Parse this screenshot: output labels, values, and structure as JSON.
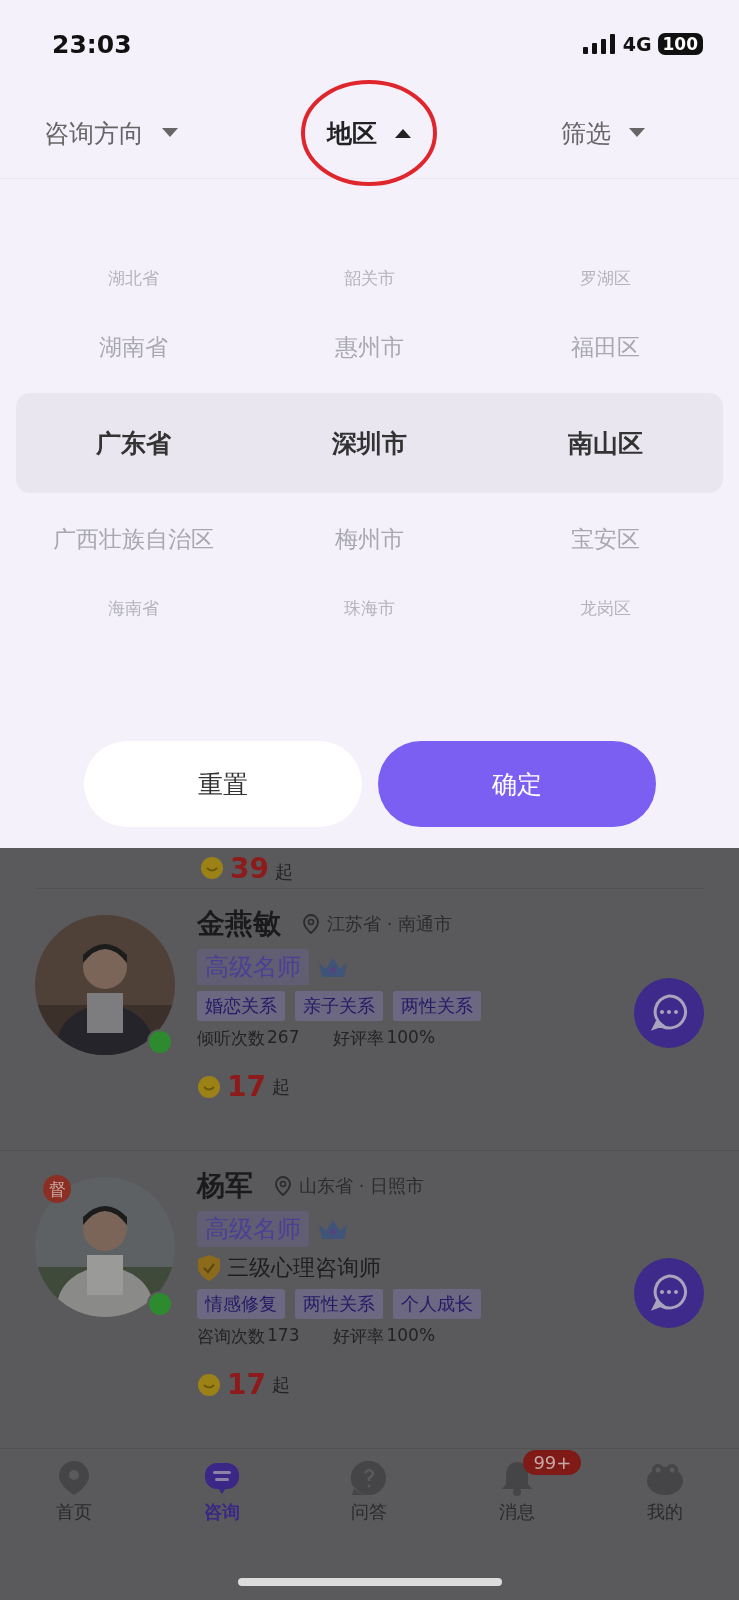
{
  "status_bar": {
    "time": "23:03",
    "network": "4G",
    "battery": "100"
  },
  "filter_tabs": [
    {
      "label": "咨询方向",
      "selected": false,
      "circled": false
    },
    {
      "label": "地区",
      "selected": true,
      "circled": true
    },
    {
      "label": "筛选",
      "selected": false,
      "circled": false
    }
  ],
  "picker": {
    "columns": [
      {
        "items": [
          {
            "label": "湖北省",
            "selected": false
          },
          {
            "label": "湖南省",
            "selected": false
          },
          {
            "label": "广东省",
            "selected": true
          },
          {
            "label": "广西壮族自治区",
            "selected": false
          },
          {
            "label": "海南省",
            "selected": false
          }
        ]
      },
      {
        "items": [
          {
            "label": "韶关市",
            "selected": false
          },
          {
            "label": "惠州市",
            "selected": false
          },
          {
            "label": "深圳市",
            "selected": true
          },
          {
            "label": "梅州市",
            "selected": false
          },
          {
            "label": "珠海市",
            "selected": false
          }
        ]
      },
      {
        "items": [
          {
            "label": "罗湖区",
            "selected": false
          },
          {
            "label": "福田区",
            "selected": false
          },
          {
            "label": "南山区",
            "selected": true
          },
          {
            "label": "宝安区",
            "selected": false
          },
          {
            "label": "龙岗区",
            "selected": false
          }
        ]
      }
    ]
  },
  "buttons": [
    {
      "label": "重置",
      "kind": "secondary"
    },
    {
      "label": "确定",
      "kind": "primary"
    }
  ],
  "list": {
    "previous_price": {
      "amount": "39",
      "unit": "起"
    },
    "counselors": [
      {
        "name": "金燕敏",
        "location": "江苏省 · 南通市",
        "title": "高级名师",
        "tags": [
          "婚恋关系",
          "亲子关系",
          "两性关系"
        ],
        "stats": [
          {
            "label": "倾听次数",
            "value": "267"
          },
          {
            "label": "好评率",
            "value": "100%"
          }
        ],
        "price": {
          "amount": "17",
          "unit": "起"
        },
        "online": true
      },
      {
        "name": "杨军",
        "location": "山东省 · 日照市",
        "title": "高级名师",
        "supervisor_badge": "督",
        "certificate": "三级心理咨询师",
        "tags": [
          "情感修复",
          "两性关系",
          "个人成长"
        ],
        "stats": [
          {
            "label": "咨询次数",
            "value": "173"
          },
          {
            "label": "好评率",
            "value": "100%"
          }
        ],
        "price": {
          "amount": "17",
          "unit": "起"
        },
        "online": true
      }
    ]
  },
  "tab_bar": [
    {
      "label": "首页",
      "selected": false
    },
    {
      "label": "咨询",
      "selected": true
    },
    {
      "label": "问答",
      "selected": false
    },
    {
      "label": "消息",
      "selected": false,
      "badge": "99+"
    },
    {
      "label": "我的",
      "selected": false
    }
  ]
}
